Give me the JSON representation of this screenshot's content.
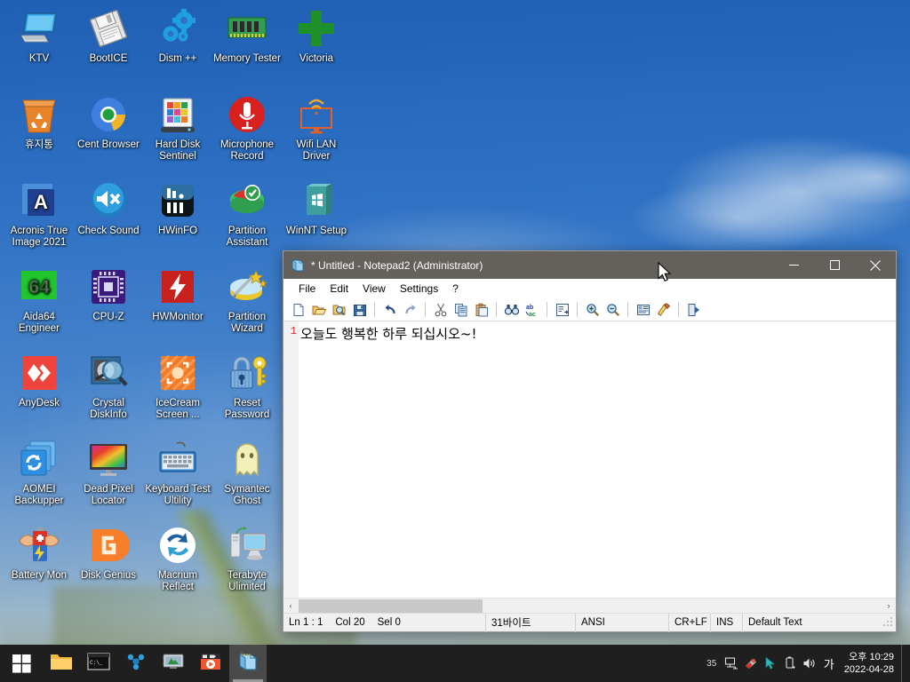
{
  "desktop": {
    "icons": [
      {
        "label": "KTV",
        "icon": "computer-monitor-icon",
        "col": 0,
        "row": 0
      },
      {
        "label": "BootICE",
        "icon": "floppy-disk-icon",
        "col": 1,
        "row": 0
      },
      {
        "label": "Dism ++",
        "icon": "gears-icon",
        "col": 2,
        "row": 0
      },
      {
        "label": "Memory Tester",
        "icon": "ram-module-icon",
        "col": 3,
        "row": 0
      },
      {
        "label": "Victoria",
        "icon": "green-cross-icon",
        "col": 4,
        "row": 0
      },
      {
        "label": "휴지통",
        "icon": "recycle-bin-icon",
        "col": 0,
        "row": 1
      },
      {
        "label": "Cent Browser",
        "icon": "cent-browser-icon",
        "col": 1,
        "row": 1
      },
      {
        "label": "Hard Disk Sentinel",
        "icon": "hard-disk-sentinel-icon",
        "col": 2,
        "row": 1
      },
      {
        "label": "Microphone Record",
        "icon": "microphone-icon",
        "col": 3,
        "row": 1
      },
      {
        "label": "Wifi LAN Driver",
        "icon": "wifi-monitor-icon",
        "col": 4,
        "row": 1
      },
      {
        "label": "Acronis True Image 2021",
        "icon": "acronis-a-icon",
        "col": 0,
        "row": 2
      },
      {
        "label": "Check Sound",
        "icon": "speaker-mute-icon",
        "col": 1,
        "row": 2
      },
      {
        "label": "HWinFO",
        "icon": "hwinfo-bars-icon",
        "col": 2,
        "row": 2
      },
      {
        "label": "Partition Assistant",
        "icon": "partition-pie-check-icon",
        "col": 3,
        "row": 2
      },
      {
        "label": "WinNT Setup",
        "icon": "windows-box-icon",
        "col": 4,
        "row": 2
      },
      {
        "label": "Aida64 Engineer",
        "icon": "aida64-icon",
        "col": 0,
        "row": 3
      },
      {
        "label": "CPU-Z",
        "icon": "cpu-chip-icon",
        "col": 1,
        "row": 3
      },
      {
        "label": "HWMonitor",
        "icon": "lightning-bolt-icon",
        "col": 2,
        "row": 3
      },
      {
        "label": "Partition Wizard",
        "icon": "partition-wand-icon",
        "col": 3,
        "row": 3
      },
      {
        "label": "AnyDesk",
        "icon": "anydesk-arrows-icon",
        "col": 0,
        "row": 4
      },
      {
        "label": "Crystal DiskInfo",
        "icon": "disk-magnifier-icon",
        "col": 1,
        "row": 4
      },
      {
        "label": "IceCream Screen ...",
        "icon": "screen-recorder-icon",
        "col": 2,
        "row": 4
      },
      {
        "label": "Reset Password",
        "icon": "lock-key-icon",
        "col": 3,
        "row": 4
      },
      {
        "label": "AOMEI Backupper",
        "icon": "backup-refresh-icon",
        "col": 0,
        "row": 5
      },
      {
        "label": "Dead Pixel Locator",
        "icon": "color-monitor-icon",
        "col": 1,
        "row": 5
      },
      {
        "label": "Keyboard Test Ultility",
        "icon": "keyboard-icon",
        "col": 2,
        "row": 5
      },
      {
        "label": "Symantec Ghost",
        "icon": "ghost-icon",
        "col": 3,
        "row": 5
      },
      {
        "label": "Battery Mon",
        "icon": "battery-muscle-icon",
        "col": 0,
        "row": 6
      },
      {
        "label": "Disk Genius",
        "icon": "disk-genius-g-icon",
        "col": 1,
        "row": 6
      },
      {
        "label": "Macrium Reflect",
        "icon": "macrium-arrows-icon",
        "col": 2,
        "row": 6
      },
      {
        "label": "Terabyte Ulimited",
        "icon": "pc-tower-monitor-icon",
        "col": 3,
        "row": 6
      }
    ]
  },
  "notepad": {
    "title": "* Untitled - Notepad2 (Administrator)",
    "window_icon": "notepad2-icon",
    "window_buttons": {
      "minimize": "minimize-button",
      "maximize": "maximize-button",
      "close": "close-button"
    },
    "menu": [
      "File",
      "Edit",
      "View",
      "Settings",
      "?"
    ],
    "toolbar": [
      {
        "name": "new-file-button",
        "title": "New"
      },
      {
        "name": "open-file-button",
        "title": "Open"
      },
      {
        "name": "browse-file-button",
        "title": "Browse"
      },
      {
        "name": "save-file-button",
        "title": "Save"
      },
      {
        "sep": true
      },
      {
        "name": "undo-button",
        "title": "Undo"
      },
      {
        "name": "redo-button",
        "title": "Redo"
      },
      {
        "sep": true
      },
      {
        "name": "cut-button",
        "title": "Cut"
      },
      {
        "name": "copy-button",
        "title": "Copy"
      },
      {
        "name": "paste-button",
        "title": "Paste"
      },
      {
        "sep": true
      },
      {
        "name": "find-button",
        "title": "Find"
      },
      {
        "name": "replace-button",
        "title": "Replace"
      },
      {
        "sep": true
      },
      {
        "name": "word-wrap-button",
        "title": "Word Wrap"
      },
      {
        "sep": true
      },
      {
        "name": "zoom-in-button",
        "title": "Zoom In"
      },
      {
        "name": "zoom-out-button",
        "title": "Zoom Out"
      },
      {
        "sep": true
      },
      {
        "name": "scheme-button",
        "title": "Scheme"
      },
      {
        "name": "customize-schemes-button",
        "title": "Customize Schemes"
      },
      {
        "sep": true
      },
      {
        "name": "exit-button",
        "title": "Exit"
      }
    ],
    "editor": {
      "line_number": "1",
      "text": "오늘도 행복한 하루 되십시오~!"
    },
    "status": {
      "line": "Ln 1 : 1",
      "col": "Col 20",
      "sel": "Sel 0",
      "bytes": "31바이트",
      "encoding": "ANSI",
      "eol": "CR+LF",
      "mode": "INS",
      "scheme": "Default Text"
    },
    "scroll": {
      "left_arrow": "‹",
      "right_arrow": "›"
    }
  },
  "taskbar": {
    "start": "start-button",
    "apps": [
      {
        "name": "file-explorer",
        "icon": "folder-icon",
        "active": false
      },
      {
        "name": "command-prompt",
        "icon": "console-icon",
        "active": false
      },
      {
        "name": "network-tool",
        "icon": "network-nodes-icon",
        "active": false
      },
      {
        "name": "remote-desktop",
        "icon": "monitor-tool-icon",
        "active": false
      },
      {
        "name": "media-player",
        "icon": "play-button-icon",
        "active": false
      },
      {
        "name": "notepad2",
        "icon": "notepad2-icon",
        "active": true
      }
    ],
    "tray": {
      "counter": "35",
      "icons": [
        "network-icon",
        "defender-icon",
        "pointer-icon",
        "usb-eject-icon",
        "volume-icon"
      ],
      "ime": "가"
    },
    "clock": {
      "time": "오후 10:29",
      "date": "2022-04-28"
    }
  },
  "colors": {
    "titlebar": "#64605c",
    "taskbar": "#1f1f1f",
    "desktop_blue": "#2f72c4",
    "linenumber_red": "#d82b2b",
    "accent_active_task": "#4a4a4a"
  }
}
